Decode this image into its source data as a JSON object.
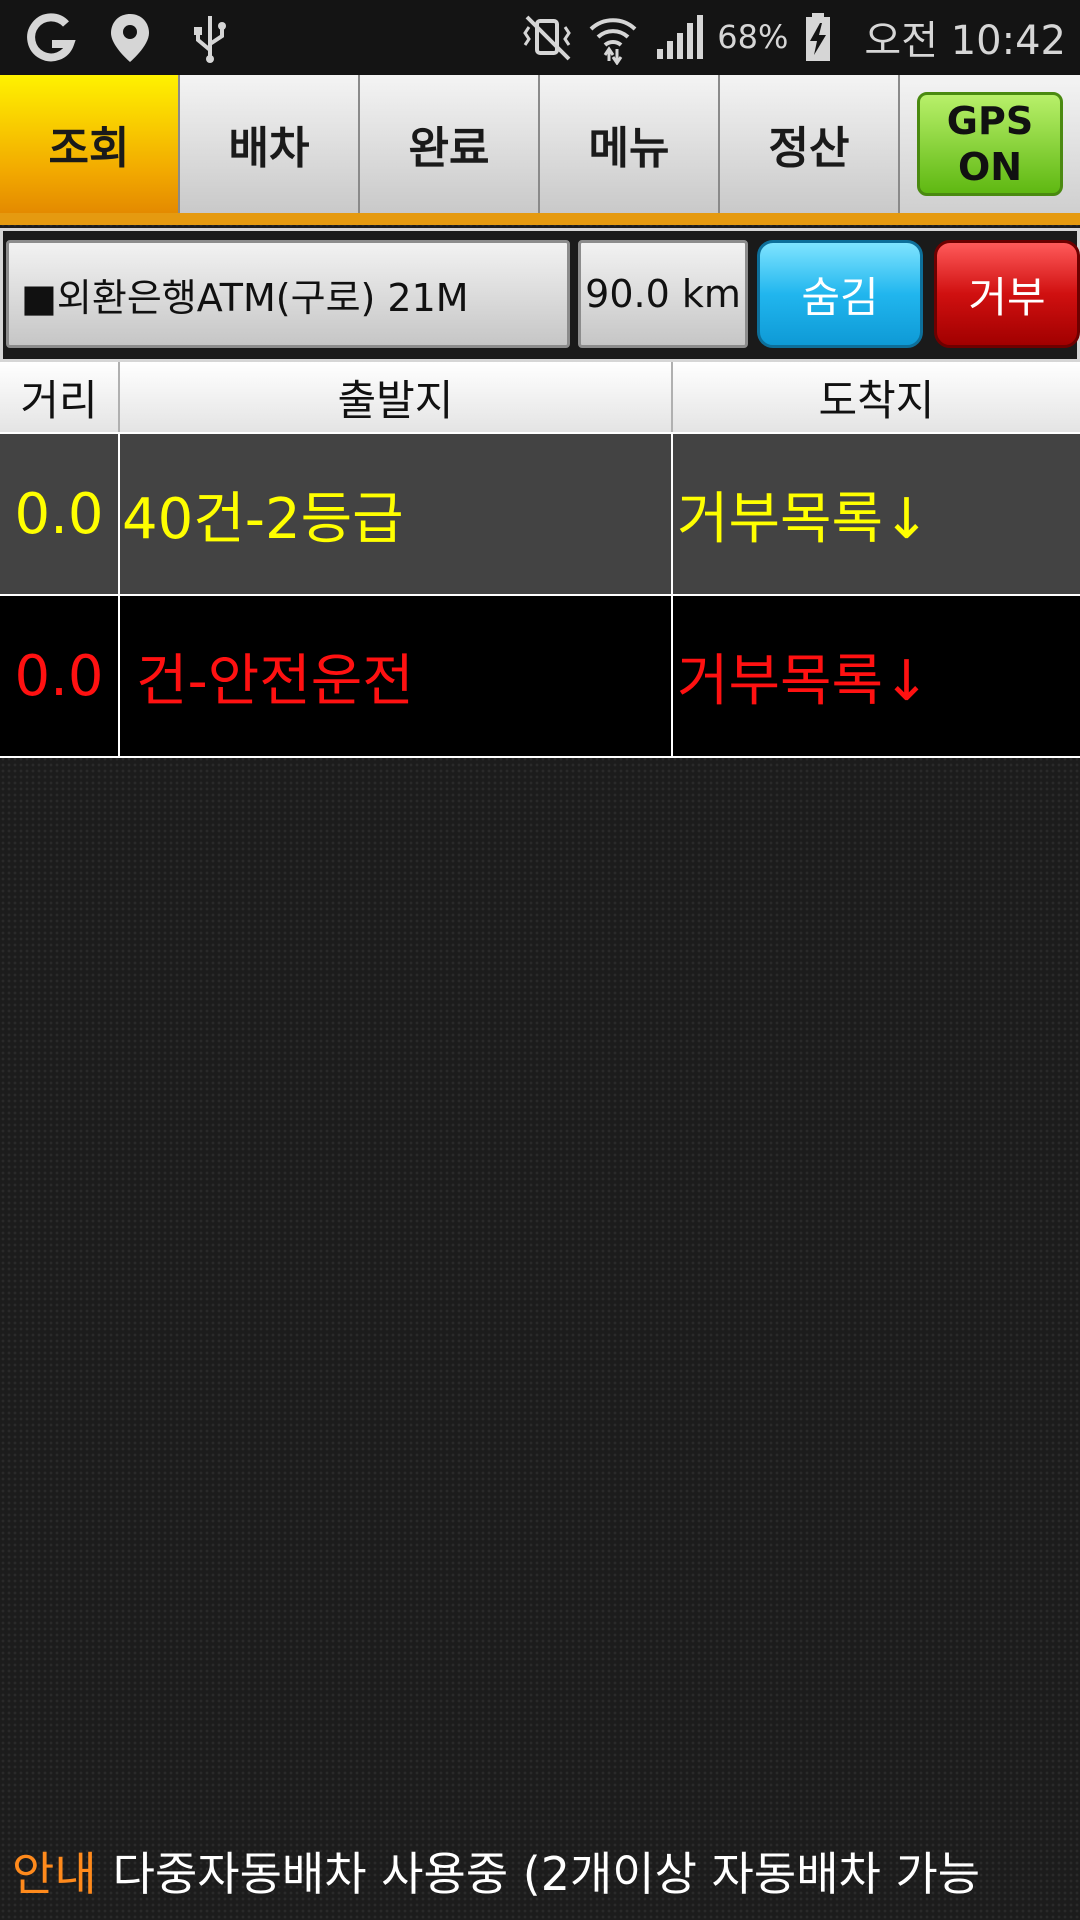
{
  "status_bar": {
    "icons_left": [
      "g-logo-icon",
      "location-pin-icon",
      "usb-icon"
    ],
    "icons_right": [
      "vibrate-mute-icon",
      "wifi-icon",
      "signal-icon",
      "battery-charging-icon"
    ],
    "battery": "68%",
    "time": "오전 10:42"
  },
  "tabs": {
    "items": [
      {
        "label": "조회",
        "active": true
      },
      {
        "label": "배차",
        "active": false
      },
      {
        "label": "완료",
        "active": false
      },
      {
        "label": "메뉴",
        "active": false
      },
      {
        "label": "정산",
        "active": false
      }
    ],
    "gps": {
      "line1": "GPS",
      "line2": "ON"
    }
  },
  "info": {
    "location": "■외환은행ATM(구로) 21M",
    "distance": "90.0 km",
    "hide_label": "숨김",
    "reject_label": "거부"
  },
  "table": {
    "headers": [
      "거리",
      "출발지",
      "도착지"
    ],
    "rows": [
      {
        "distance": "0.0",
        "origin": "40건-2등급",
        "destination": "거부목록↓",
        "color": "#ffff00"
      },
      {
        "distance": "0.0",
        "origin": "건-안전운전",
        "destination": "거부목록↓",
        "color": "#ff1111"
      }
    ]
  },
  "notice": {
    "label": "안내",
    "message": "다중자동배차 사용중 (2개이상 자동배차 가능"
  },
  "colors": {
    "active_tab": "#f2a900",
    "gps_green": "#5fb812",
    "hide_blue": "#21b6ee",
    "reject_red": "#d01010",
    "notice_orange": "#ff8a1c"
  }
}
